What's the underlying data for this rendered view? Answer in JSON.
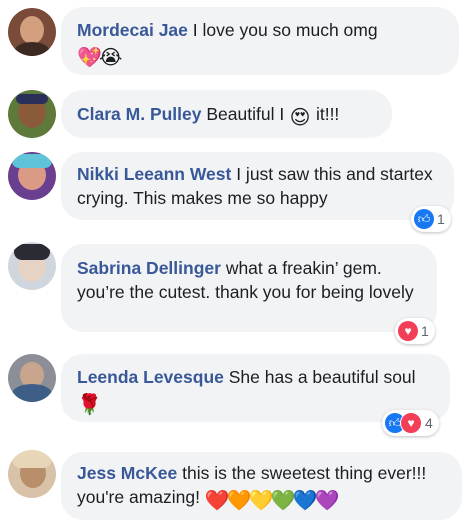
{
  "comments": [
    {
      "name": "Mordecai Jae",
      "text": "I love you so much omg",
      "emojis": [
        "💖",
        "😭"
      ],
      "reactions": null
    },
    {
      "name": "Clara M. Pulley",
      "text_before": "Beautiful I",
      "emoji_mid": "😍",
      "text_after": "it!!!",
      "reactions": null
    },
    {
      "name": "Nikki Leeann West",
      "text": "I just saw this and startex crying. This makes me so happy",
      "reactions": {
        "icons": [
          "like-icon"
        ],
        "count": "1"
      }
    },
    {
      "name": "Sabrina Dellinger",
      "text": "what a freakin’ gem. you’re the cutest. thank you for being lovely",
      "reactions": {
        "icons": [
          "love-icon"
        ],
        "count": "1"
      }
    },
    {
      "name": "Leenda Levesque",
      "text": "She has a beautiful soul",
      "emojis": [
        "🌹"
      ],
      "reactions": {
        "icons": [
          "like-icon",
          "love-icon"
        ],
        "count": "4"
      }
    },
    {
      "name": "Jess McKee",
      "text": "this is the sweetest thing ever!!! you're amazing!",
      "emojis": [
        "❤️",
        "🧡",
        "💛",
        "💚",
        "💙",
        "💜"
      ],
      "reactions": null
    }
  ],
  "colors": {
    "name": "#385898",
    "bubble": "#f2f3f5",
    "like": "#1877f2",
    "love": "#f33e58"
  }
}
